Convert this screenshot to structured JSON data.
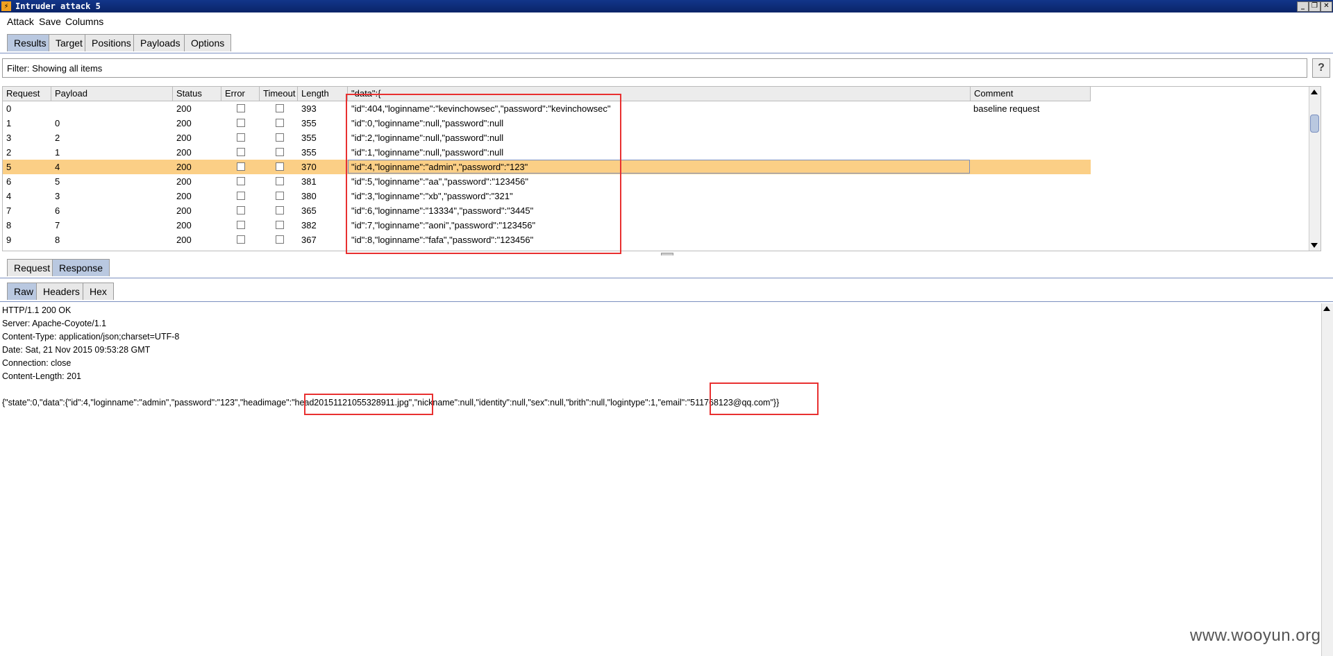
{
  "window": {
    "title": "Intruder attack 5"
  },
  "menu": [
    "Attack",
    "Save",
    "Columns"
  ],
  "main_tabs": [
    "Results",
    "Target",
    "Positions",
    "Payloads",
    "Options"
  ],
  "filter": {
    "text": "Filter: Showing all items"
  },
  "help_label": "?",
  "table": {
    "columns": [
      "Request",
      "Payload",
      "Status",
      "Error",
      "Timeout",
      "Length",
      "\"data\":{",
      "Comment"
    ],
    "rows": [
      {
        "request": "0",
        "payload": "",
        "status": "200",
        "error": false,
        "timeout": false,
        "length": "393",
        "data": "\"id\":404,\"loginname\":\"kevinchowsec\",\"password\":\"kevinchowsec\"",
        "comment": "baseline request"
      },
      {
        "request": "1",
        "payload": "0",
        "status": "200",
        "error": false,
        "timeout": false,
        "length": "355",
        "data": "\"id\":0,\"loginname\":null,\"password\":null",
        "comment": ""
      },
      {
        "request": "3",
        "payload": "2",
        "status": "200",
        "error": false,
        "timeout": false,
        "length": "355",
        "data": "\"id\":2,\"loginname\":null,\"password\":null",
        "comment": ""
      },
      {
        "request": "2",
        "payload": "1",
        "status": "200",
        "error": false,
        "timeout": false,
        "length": "355",
        "data": "\"id\":1,\"loginname\":null,\"password\":null",
        "comment": ""
      },
      {
        "request": "5",
        "payload": "4",
        "status": "200",
        "error": false,
        "timeout": false,
        "length": "370",
        "data": "\"id\":4,\"loginname\":\"admin\",\"password\":\"123\"",
        "comment": "",
        "selected": true
      },
      {
        "request": "6",
        "payload": "5",
        "status": "200",
        "error": false,
        "timeout": false,
        "length": "381",
        "data": "\"id\":5,\"loginname\":\"aa\",\"password\":\"123456\"",
        "comment": ""
      },
      {
        "request": "4",
        "payload": "3",
        "status": "200",
        "error": false,
        "timeout": false,
        "length": "380",
        "data": "\"id\":3,\"loginname\":\"xb\",\"password\":\"321\"",
        "comment": ""
      },
      {
        "request": "7",
        "payload": "6",
        "status": "200",
        "error": false,
        "timeout": false,
        "length": "365",
        "data": "\"id\":6,\"loginname\":\"13334\",\"password\":\"3445\"",
        "comment": ""
      },
      {
        "request": "8",
        "payload": "7",
        "status": "200",
        "error": false,
        "timeout": false,
        "length": "382",
        "data": "\"id\":7,\"loginname\":\"aoni\",\"password\":\"123456\"",
        "comment": ""
      },
      {
        "request": "9",
        "payload": "8",
        "status": "200",
        "error": false,
        "timeout": false,
        "length": "367",
        "data": "\"id\":8,\"loginname\":\"fafa\",\"password\":\"123456\"",
        "comment": ""
      }
    ]
  },
  "req_resp_tabs": [
    "Request",
    "Response"
  ],
  "view_tabs": [
    "Raw",
    "Headers",
    "Hex"
  ],
  "response": {
    "lines": [
      "HTTP/1.1 200 OK",
      "Server: Apache-Coyote/1.1",
      "Content-Type: application/json;charset=UTF-8",
      "Date: Sat, 21 Nov 2015 09:53:28 GMT",
      "Connection: close",
      "Content-Length: 201"
    ],
    "body": "{\"state\":0,\"data\":{\"id\":4,\"loginname\":\"admin\",\"password\":\"123\",\"headimage\":\"head20151121055328911.jpg\",\"nickname\":null,\"identity\":null,\"sex\":null,\"brith\":null,\"logintype\":1,\"email\":\"511768123@qq.com\"}}"
  },
  "watermark": "www.wooyun.org",
  "colors": {
    "selected_row": "#fbcf86",
    "active_tab": "#b9c8e0",
    "highlight_box": "#e83030",
    "title_bar": "#0a2468"
  }
}
